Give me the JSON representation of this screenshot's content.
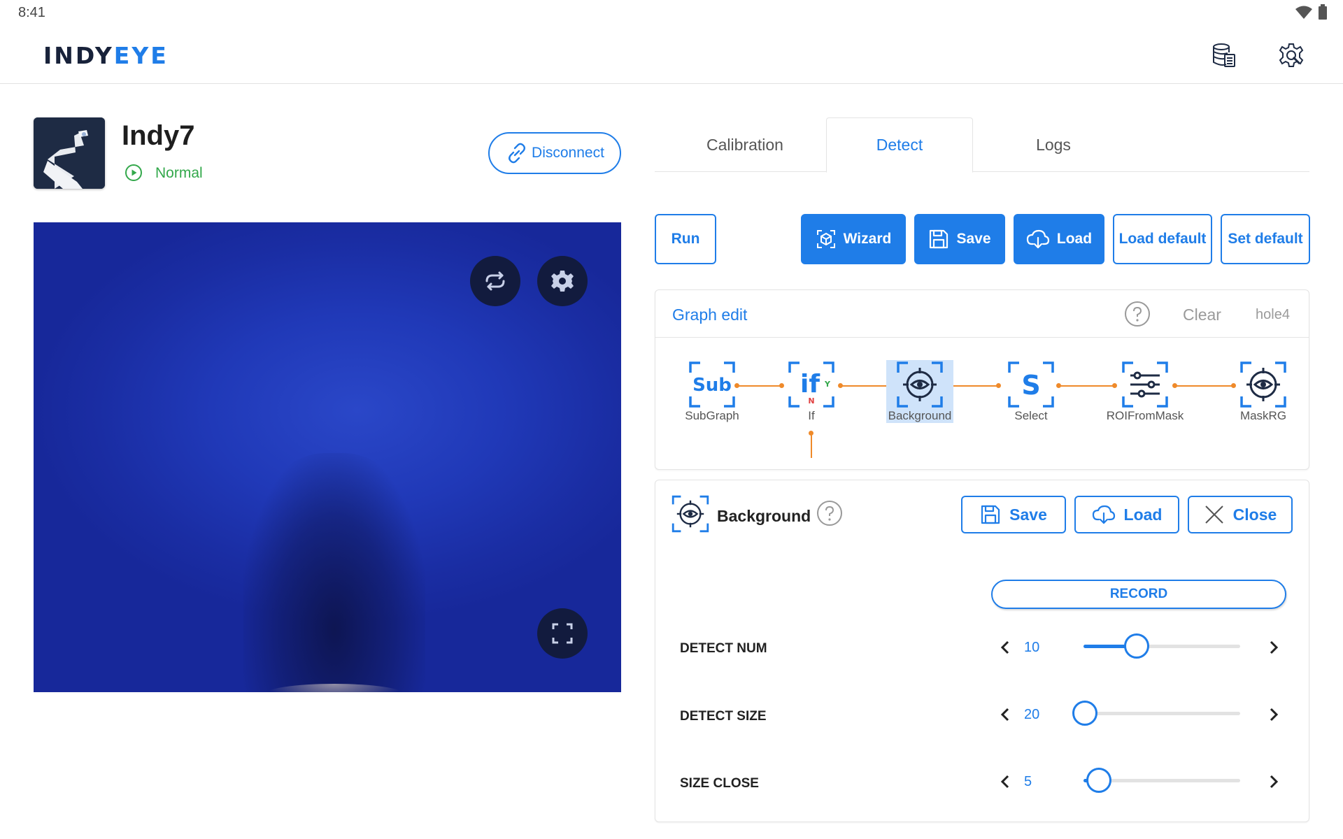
{
  "statusbar": {
    "time": "8:41"
  },
  "app": {
    "logo_part1": "INDY",
    "logo_part2": "EYE"
  },
  "robot": {
    "name": "Indy7",
    "status": "Normal",
    "disconnect_label": "Disconnect"
  },
  "tabs": [
    {
      "label": "Calibration",
      "active": false
    },
    {
      "label": "Detect",
      "active": true
    },
    {
      "label": "Logs",
      "active": false
    }
  ],
  "actions": {
    "run": "Run",
    "wizard": "Wizard",
    "save": "Save",
    "load": "Load",
    "load_default": "Load default",
    "set_default": "Set default"
  },
  "graph": {
    "title": "Graph edit",
    "clear": "Clear",
    "name": "hole4",
    "if_yes": "Y",
    "if_no": "N",
    "nodes": [
      {
        "label": "SubGraph",
        "icon": "subgraph-icon",
        "glyph": "Sub"
      },
      {
        "label": "If",
        "icon": "if-icon",
        "glyph": "if"
      },
      {
        "label": "Background",
        "icon": "background-eye-icon",
        "selected": true
      },
      {
        "label": "Select",
        "icon": "select-icon",
        "glyph": "S"
      },
      {
        "label": "ROIFromMask",
        "icon": "sliders-icon"
      },
      {
        "label": "MaskRG",
        "icon": "target-eye-icon"
      }
    ]
  },
  "background": {
    "title": "Background",
    "save": "Save",
    "load": "Load",
    "close": "Close",
    "record": "RECORD",
    "params": [
      {
        "label": "DETECT NUM",
        "value": "10",
        "level": 0.34
      },
      {
        "label": "DETECT SIZE",
        "value": "20",
        "level": 0.01
      },
      {
        "label": "SIZE CLOSE",
        "value": "5",
        "level": 0.1
      }
    ]
  },
  "colors": {
    "accent": "#1f7de8",
    "status_ok": "#33a84b",
    "connector": "#ef8a2a",
    "header_dark": "#18223a"
  }
}
